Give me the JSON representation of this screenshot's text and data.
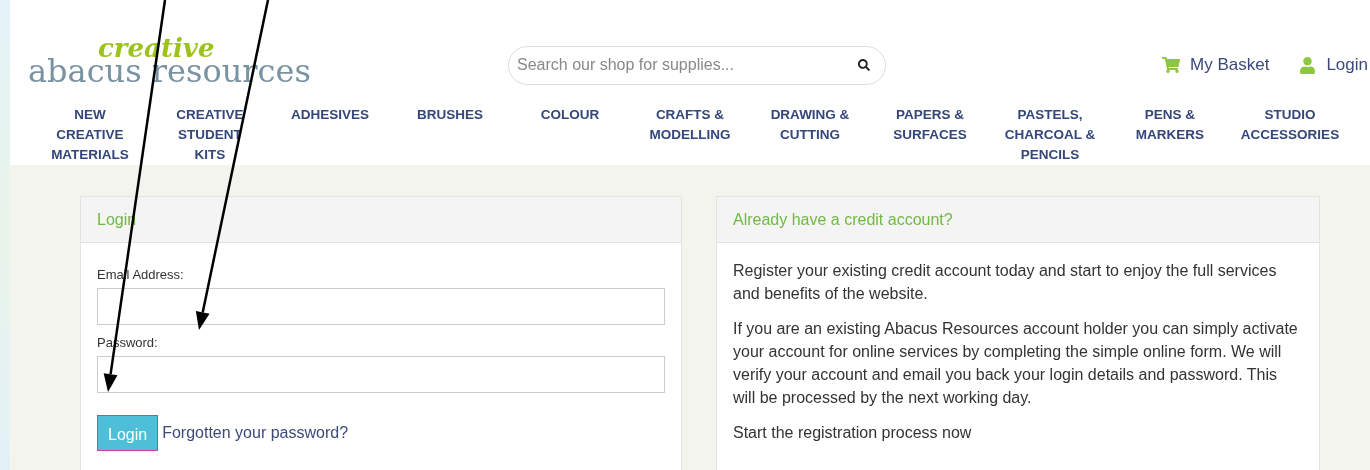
{
  "header": {
    "logo": {
      "top": "creative",
      "main": "abacus resources"
    },
    "search": {
      "placeholder": "Search our shop for supplies..."
    },
    "links": [
      {
        "kind": "basket",
        "label": "My Basket"
      },
      {
        "kind": "user",
        "label": "Login"
      }
    ]
  },
  "nav": [
    "NEW\nCREATIVE\nMATERIALS",
    "CREATIVE\nSTUDENT\nKITS",
    "ADHESIVES",
    "BRUSHES",
    "COLOUR",
    "CRAFTS &\nMODELLING",
    "DRAWING &\nCUTTING",
    "PAPERS &\nSURFACES",
    "PASTELS,\nCHARCOAL &\nPENCILS",
    "PENS &\nMARKERS",
    "STUDIO\nACCESSORIES"
  ],
  "login_panel": {
    "title": "Login",
    "fields": [
      "Email Address:",
      "Password:"
    ],
    "button": "Login",
    "forgot_link": "Forgotten your password?"
  },
  "credit_panel": {
    "title": "Already have a credit account?",
    "paragraphs": [
      "Register your existing credit account today and start to enjoy the full services and benefits of the website.",
      "If you are an existing Abacus Resources account holder you can simply activate your account for online services by completing the simple online form. We will verify your account and email you back your login details and password. This will be processed by the next working day.",
      "Start the registration process now"
    ]
  }
}
